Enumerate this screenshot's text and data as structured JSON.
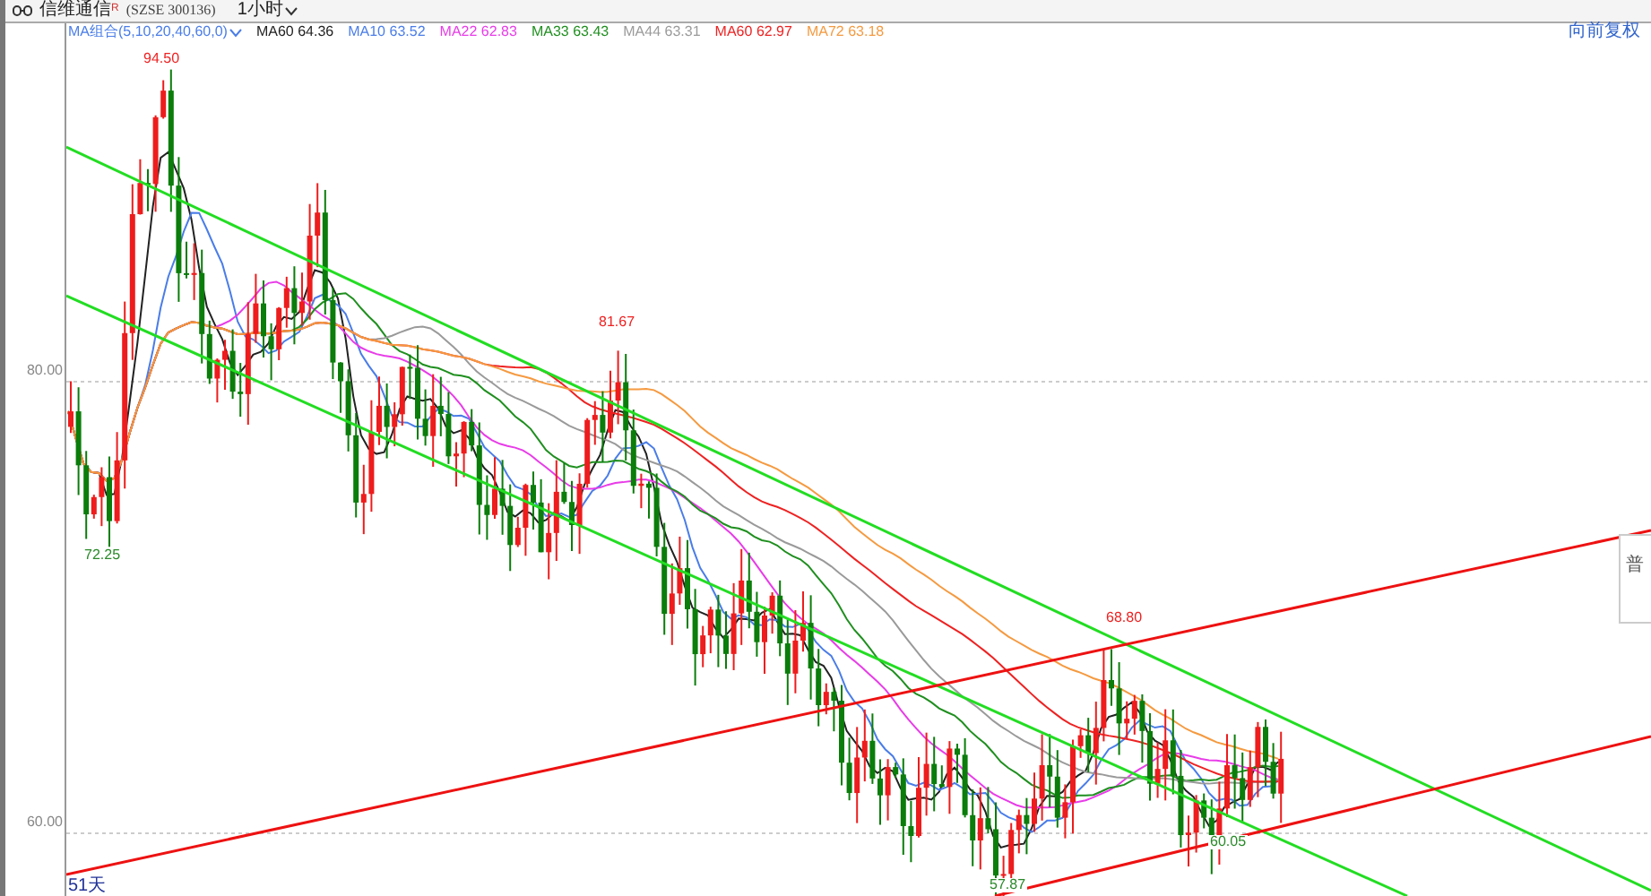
{
  "header": {
    "title": "信维通信$^{R}$",
    "code": "(SZSE 300136)",
    "period": "1小时"
  },
  "legend": {
    "group": "MA组合(5,10,20,40,60,0)",
    "items": [
      {
        "name": "MA60",
        "value": "64.36",
        "color": "#222222"
      },
      {
        "name": "MA10",
        "value": "63.52",
        "color": "#4a7de8"
      },
      {
        "name": "MA22",
        "value": "62.83",
        "color": "#e83ce8"
      },
      {
        "name": "MA33",
        "value": "63.43",
        "color": "#1f8f1f"
      },
      {
        "name": "MA44",
        "value": "63.31",
        "color": "#9a9a9a"
      },
      {
        "name": "MA60",
        "value": "62.97",
        "color": "#ee2222"
      },
      {
        "name": "MA72",
        "value": "63.18",
        "color": "#f59a40"
      }
    ]
  },
  "adjust": "向前复权",
  "price_axis": [
    "80.00",
    "60.00"
  ],
  "price_marks": [
    {
      "text": "94.50",
      "kind": "high"
    },
    {
      "text": "81.67",
      "kind": "high"
    },
    {
      "text": "72.25",
      "kind": "low"
    },
    {
      "text": "68.80",
      "kind": "high"
    },
    {
      "text": "60.05",
      "kind": "low"
    },
    {
      "text": "57.87",
      "kind": "low"
    }
  ],
  "span": "51天",
  "side_panel": "普"
}
